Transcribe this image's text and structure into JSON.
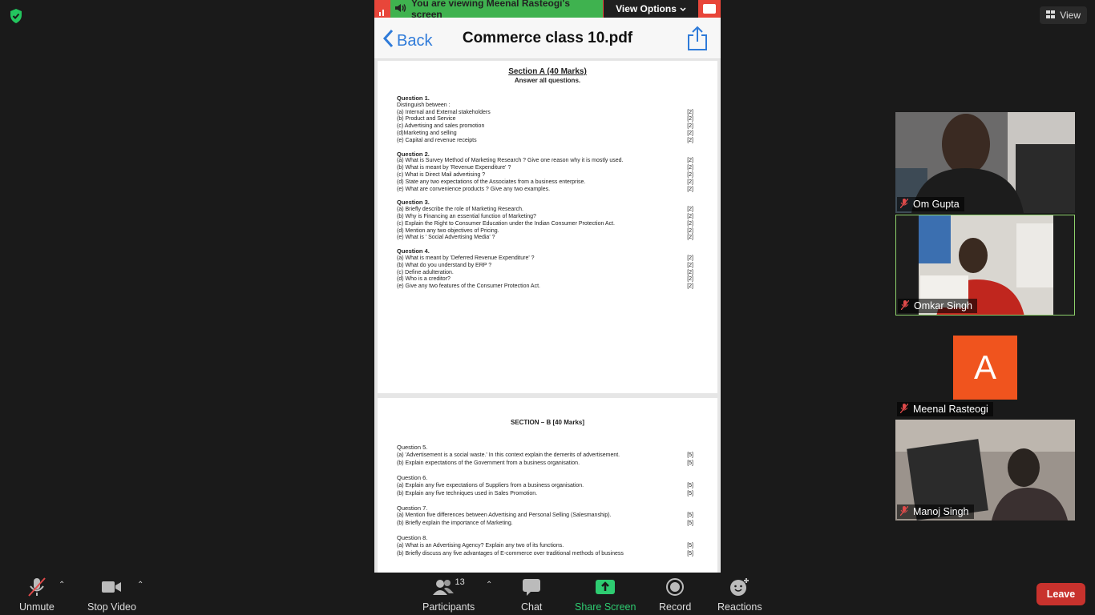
{
  "top": {
    "view_label": "View"
  },
  "banner": {
    "viewing_text": "You are viewing Meenal Rasteogi's screen",
    "view_options_label": "View Options"
  },
  "pdf": {
    "back_label": "Back",
    "title": "Commerce class 10.pdf",
    "page1": {
      "section_title": "Section A (40 Marks)",
      "section_sub": "Answer all questions.",
      "questions": [
        {
          "head": "Question 1.",
          "lines": [
            {
              "t": "Distinguish between :",
              "m": ""
            },
            {
              "t": "(a) Internal and External stakeholders",
              "m": "[2]"
            },
            {
              "t": "(b) Product and Service",
              "m": "[2]"
            },
            {
              "t": "(c) Advertising and sales promotion",
              "m": "[2]"
            },
            {
              "t": "(d)Marketing and selling",
              "m": "[2]"
            },
            {
              "t": "(e) Capital and revenue receipts",
              "m": "[2]"
            }
          ]
        },
        {
          "head": "Question 2.",
          "lines": [
            {
              "t": "(a) What is Survey Method of Marketing Research ? Give one reason why it is mostly used.",
              "m": "[2]"
            },
            {
              "t": "(b) What is meant by 'Revenue Expenditure' ?",
              "m": "[2]"
            },
            {
              "t": "(c) What is Direct Mail advertising ?",
              "m": "[2]"
            },
            {
              "t": "(d) State any two expectations of the Associates from a business enterprise.",
              "m": "[2]"
            },
            {
              "t": "(e) What are convenience products ? Give any two examples.",
              "m": "[2]"
            }
          ]
        },
        {
          "head": "Question 3.",
          "lines": [
            {
              "t": "(a) Briefly describe the role of Marketing Research.",
              "m": "[2]"
            },
            {
              "t": "(b) Why is Financing an essential function of Marketing?",
              "m": "[2]"
            },
            {
              "t": "(c) Explain the Right to Consumer Education under the Indian Consumer Protection Act.",
              "m": "[2]"
            },
            {
              "t": "(d) Mention any two objectives of Pricing.",
              "m": "[2]"
            },
            {
              "t": "(e) What is ' Social Advertising Media' ?",
              "m": "[2]"
            }
          ]
        },
        {
          "head": "Question 4.",
          "lines": [
            {
              "t": "(a) What is meant by 'Deferred Revenue Expenditure' ?",
              "m": "[2]"
            },
            {
              "t": "(b) What do you understand by ERP ?",
              "m": "[2]"
            },
            {
              "t": "(c) Define adulteration.",
              "m": "[2]"
            },
            {
              "t": "(d) Who is a creditor?",
              "m": "[2]"
            },
            {
              "t": "(e) Give any two features of the Consumer Protection Act.",
              "m": "[2]"
            }
          ]
        }
      ]
    },
    "page2": {
      "section_title": "SECTION – B [40 Marks]",
      "questions": [
        {
          "head": "Question 5.",
          "lines": [
            {
              "t": "(a) 'Advertisement is a social waste.' In this context explain the demerits of advertisement.",
              "m": "[5]"
            },
            {
              "t": "(b) Explain expectations of the Government from a business organisation.",
              "m": "[5]"
            }
          ]
        },
        {
          "head": "Question 6.",
          "lines": [
            {
              "t": "(a) Explain any five expectations of Suppliers from a business organisation.",
              "m": "[5]"
            },
            {
              "t": "(b) Explain any five techniques used in Sales Promotion.",
              "m": "[5]"
            }
          ]
        },
        {
          "head": "Question 7.",
          "lines": [
            {
              "t": "(a) Mention five differences between Advertising and Personal Selling (Salesmanship).",
              "m": "[5]"
            },
            {
              "t": "(b) Briefly explain the importance of Marketing.",
              "m": "[5]"
            }
          ]
        },
        {
          "head": "Question 8.",
          "lines": [
            {
              "t": "(a) What is an Advertising Agency? Explain any two of its functions.",
              "m": "[5]"
            },
            {
              "t": "(b) Briefly discuss any five advantages of E-commerce over traditional methods of business",
              "m": "[5]"
            }
          ]
        }
      ]
    }
  },
  "participants_gallery": [
    {
      "name": "Om Gupta"
    },
    {
      "name": "Omkar Singh"
    },
    {
      "name": "Meenal Rasteogi",
      "avatar_letter": "A"
    },
    {
      "name": "Manoj Singh"
    }
  ],
  "toolbar": {
    "unmute": "Unmute",
    "stop_video": "Stop Video",
    "participants": "Participants",
    "participants_count": "13",
    "chat": "Chat",
    "share_screen": "Share Screen",
    "record": "Record",
    "reactions": "Reactions",
    "leave": "Leave"
  },
  "colors": {
    "banner_green": "#3fb24f",
    "banner_red": "#e8463a",
    "leave_red": "#c8322d",
    "share_green": "#2ecc71",
    "avatar_orange": "#f0541e",
    "active_border": "#8dd16b"
  }
}
